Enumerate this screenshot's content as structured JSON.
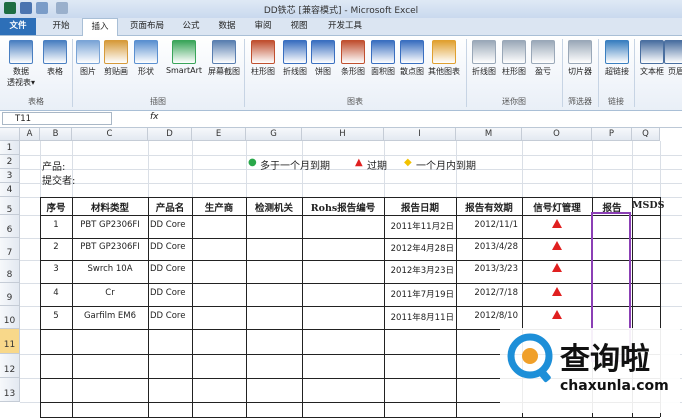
{
  "window": {
    "title": "DD铁芯  [兼容模式] - Microsoft Excel"
  },
  "tabs": [
    "文件",
    "开始",
    "插入",
    "页面布局",
    "公式",
    "数据",
    "审阅",
    "视图",
    "开发工具"
  ],
  "ribbon": {
    "buttons": [
      {
        "label": "数据\n透视表▾",
        "icon": "pivot-table-icon",
        "color": "#4a7fc1"
      },
      {
        "label": "表格",
        "icon": "table-icon",
        "color": "#4a7fc1"
      },
      {
        "label": "图片",
        "icon": "picture-icon",
        "color": "#7aa4d6"
      },
      {
        "label": "剪贴画",
        "icon": "clipart-icon",
        "color": "#d69a3a"
      },
      {
        "label": "形状",
        "icon": "shapes-icon",
        "color": "#5a8fd0"
      },
      {
        "label": "SmartArt",
        "icon": "smartart-icon",
        "color": "#3aa55a"
      },
      {
        "label": "屏幕截图",
        "icon": "screenshot-icon",
        "color": "#5a7fb0"
      },
      {
        "label": "柱形图",
        "icon": "column-chart-icon",
        "color": "#c04f2f"
      },
      {
        "label": "折线图",
        "icon": "line-chart-icon",
        "color": "#3a6fc0"
      },
      {
        "label": "饼图",
        "icon": "pie-chart-icon",
        "color": "#3a6fc0"
      },
      {
        "label": "条形图",
        "icon": "bar-chart-icon",
        "color": "#c04f2f"
      },
      {
        "label": "面积图",
        "icon": "area-chart-icon",
        "color": "#3a6fc0"
      },
      {
        "label": "散点图",
        "icon": "scatter-chart-icon",
        "color": "#3a6fc0"
      },
      {
        "label": "其他图表",
        "icon": "other-charts-icon",
        "color": "#e0a030"
      },
      {
        "label": "折线图",
        "icon": "sparkline-line-icon",
        "color": "#9aa8b8"
      },
      {
        "label": "柱形图",
        "icon": "sparkline-column-icon",
        "color": "#9aa8b8"
      },
      {
        "label": "盈亏",
        "icon": "sparkline-winloss-icon",
        "color": "#9aa8b8"
      },
      {
        "label": "切片器",
        "icon": "slicer-icon",
        "color": "#9aa8b8"
      },
      {
        "label": "超链接",
        "icon": "hyperlink-icon",
        "color": "#3a7fc0"
      },
      {
        "label": "文本框",
        "icon": "textbox-icon",
        "color": "#4a6fa0"
      },
      {
        "label": "页眉",
        "icon": "header-icon",
        "color": "#4a6fa0"
      }
    ],
    "groups": [
      "表格",
      "插图",
      "图表",
      "迷你图",
      "筛选器",
      "链接"
    ]
  },
  "formula_bar": {
    "name_box": "T11",
    "fx": "fx"
  },
  "columns": [
    "A",
    "B",
    "C",
    "D",
    "E",
    "G",
    "H",
    "I",
    "M",
    "O",
    "P",
    "Q"
  ],
  "rows": [
    "1",
    "2",
    "3",
    "4",
    "5",
    "6",
    "7",
    "8",
    "9",
    "10",
    "11",
    "12",
    "13"
  ],
  "sheet": {
    "product_label": "产品:",
    "submitter_label": "提交者:",
    "legend": [
      {
        "symbol": "●",
        "text": "多于一个月到期",
        "color": "#2aa84a"
      },
      {
        "symbol": "▲",
        "text": "过期",
        "color": "#e02020"
      },
      {
        "symbol": "◆",
        "text": "一个月内到期",
        "color": "#f2c200"
      }
    ],
    "headers": [
      "序号",
      "材料类型",
      "产品名",
      "生产商",
      "检测机关",
      "Rohs报告编号",
      "报告日期",
      "报告有效期",
      "信号灯管理",
      "报告",
      "MSDS"
    ],
    "data_rows": [
      {
        "no": "1",
        "material": "PBT GP2306FI",
        "product": "DD Core",
        "date": "2011年11月2日",
        "valid": "2012/11/1"
      },
      {
        "no": "2",
        "material": "PBT GP2306FI",
        "product": "DD Core",
        "date": "2012年4月28日",
        "valid": "2013/4/28"
      },
      {
        "no": "3",
        "material": "Swrch 10A",
        "product": "DD Core",
        "date": "2012年3月23日",
        "valid": "2013/3/23"
      },
      {
        "no": "4",
        "material": "Cr",
        "product": "DD Core",
        "date": "2011年7月19日",
        "valid": "2012/7/18"
      },
      {
        "no": "5",
        "material": "Garfilm EM6",
        "product": "DD Core",
        "date": "2011年8月11日",
        "valid": "2012/8/10"
      }
    ],
    "signal_color": "#e02020",
    "highlight_color": "#8b3fb5"
  },
  "watermark": {
    "text": "查询啦",
    "url": "chaxunla.com"
  }
}
